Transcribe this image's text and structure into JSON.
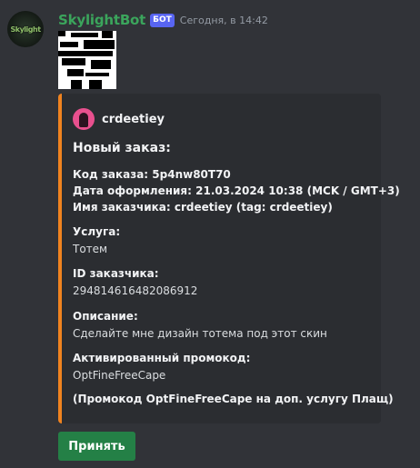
{
  "message": {
    "author": "SkylightBot",
    "bot_tag": "БОТ",
    "timestamp": "Сегодня, в 14:42",
    "avatar_text": "Skylight"
  },
  "embed": {
    "accent_color": "#f0831f",
    "author_name": "crdeetiey",
    "title": "Новый заказ:",
    "details": [
      "Код заказа: 5p4nw80T70",
      "Дата оформления: 21.03.2024 10:38 (MCK / GMT+3)",
      "Имя заказчика: crdeetiey (tag: crdeetiey)"
    ],
    "fields": [
      {
        "name": "Услуга:",
        "value": "Тотем"
      },
      {
        "name": "ID заказчика:",
        "value": "294814616482086912"
      },
      {
        "name": "Описание:",
        "value": "Сделайте мне дизайн тотема под этот скин"
      },
      {
        "name": "Активированный промокод:",
        "value": "OptFineFreeCape"
      }
    ],
    "footer_note": "(Промокод OptFineFreeCape на доп. услугу Плащ)"
  },
  "buttons": {
    "accept_label": "Принять",
    "accept_color": "#248046"
  }
}
